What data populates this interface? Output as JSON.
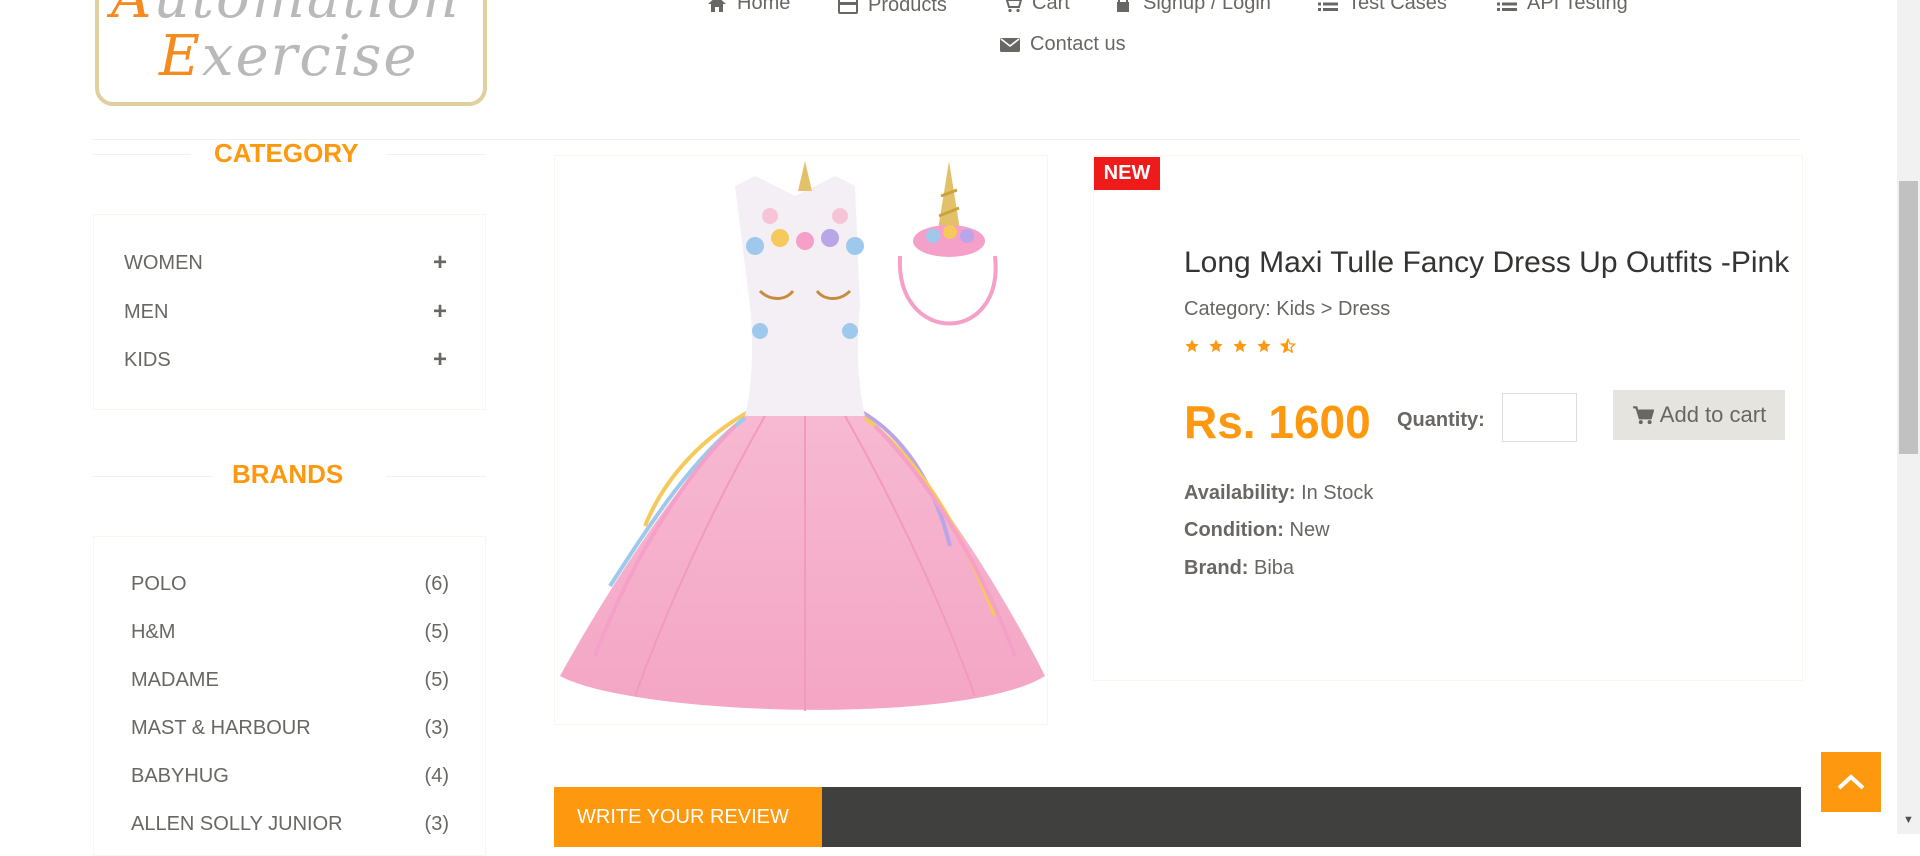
{
  "logo": {
    "line1": "Automation",
    "line2": "Exercise"
  },
  "nav": {
    "home": "Home",
    "products": "Products",
    "cart": "Cart",
    "signup": "Signup / Login",
    "test_cases": "Test Cases",
    "api_testing": "API Testing",
    "contact": "Contact us"
  },
  "category": {
    "title": "CATEGORY",
    "items": [
      {
        "label": "WOMEN",
        "icon": "plus-icon"
      },
      {
        "label": "MEN",
        "icon": "plus-icon"
      },
      {
        "label": "KIDS",
        "icon": "plus-icon"
      }
    ]
  },
  "brands": {
    "title": "BRANDS",
    "items": [
      {
        "label": "POLO",
        "count": "(6)"
      },
      {
        "label": "H&M",
        "count": "(5)"
      },
      {
        "label": "MADAME",
        "count": "(5)"
      },
      {
        "label": "MAST & HARBOUR",
        "count": "(3)"
      },
      {
        "label": "BABYHUG",
        "count": "(4)"
      },
      {
        "label": "ALLEN SOLLY JUNIOR",
        "count": "(3)"
      }
    ]
  },
  "product": {
    "badge": "NEW",
    "name": "Long Maxi Tulle Fancy Dress Up Outfits -Pink",
    "category": "Category: Kids > Dress",
    "rating": 4.5,
    "price": "Rs. 1600",
    "quantity_label": "Quantity:",
    "quantity_value": "",
    "add_to_cart": "Add to cart",
    "availability_label": "Availability:",
    "availability_value": " In Stock",
    "condition_label": "Condition:",
    "condition_value": " New",
    "brand_label": "Brand:",
    "brand_value": " Biba"
  },
  "review": {
    "tab_label": "WRITE YOUR REVIEW"
  },
  "colors": {
    "accent": "#fe980f",
    "badge": "#ef1b1b",
    "dark_bar": "#40403e"
  }
}
